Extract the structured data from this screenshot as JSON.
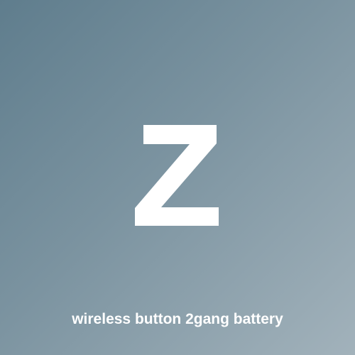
{
  "tile": {
    "icon_name": "z-letter-icon",
    "icon_color": "#ffffff",
    "caption": "wireless button 2gang battery",
    "caption_color": "#ffffff",
    "background_gradient": [
      "#5f7d8d",
      "#7b93a0",
      "#a2b2bb"
    ]
  }
}
